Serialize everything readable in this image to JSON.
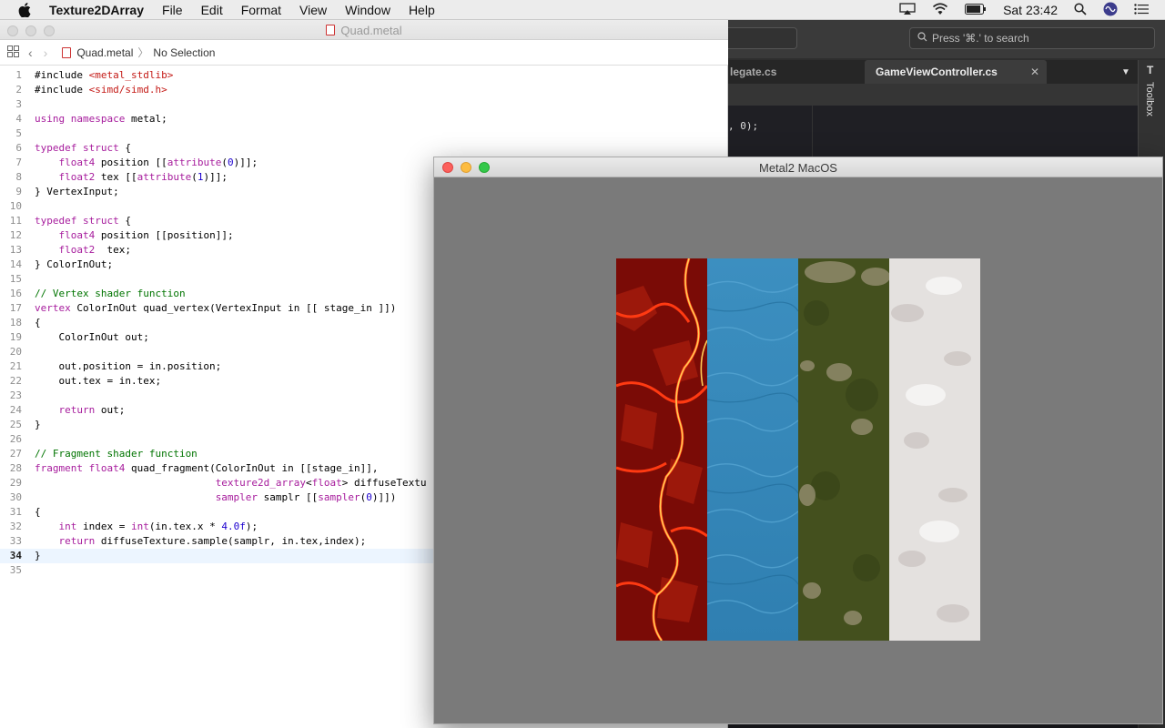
{
  "menubar": {
    "app_name": "Texture2DArray",
    "items": [
      "File",
      "Edit",
      "Format",
      "View",
      "Window",
      "Help"
    ],
    "clock": "Sat 23:42"
  },
  "editor": {
    "title": "Quad.metal",
    "breadcrumb_file": "Quad.metal",
    "breadcrumb_selection": "No Selection",
    "active_line": 34,
    "lines": [
      "#include <metal_stdlib>",
      "#include <simd/simd.h>",
      "",
      "using namespace metal;",
      "",
      "typedef struct {",
      "    float4 position [[attribute(0)]];",
      "    float2 tex [[attribute(1)]];",
      "} VertexInput;",
      "",
      "typedef struct {",
      "    float4 position [[position]];",
      "    float2  tex;",
      "} ColorInOut;",
      "",
      "// Vertex shader function",
      "vertex ColorInOut quad_vertex(VertexInput in [[ stage_in ]])",
      "{",
      "    ColorInOut out;",
      "",
      "    out.position = in.position;",
      "    out.tex = in.tex;",
      "",
      "    return out;",
      "}",
      "",
      "// Fragment shader function",
      "fragment float4 quad_fragment(ColorInOut in [[stage_in]],",
      "                              texture2d_array<float> diffuseTextu",
      "                              sampler samplr [[sampler(0)]])",
      "{",
      "    int index = int(in.tex.x * 4.0f);",
      "    return diffuseTexture.sample(samplr, in.tex,index);",
      "}",
      ""
    ]
  },
  "ide": {
    "search_placeholder": "Press '⌘.' to search",
    "tab_partial": "legate.cs",
    "tab_active": "GameViewController.cs",
    "code_snippet": ", 0);",
    "toolbox_label": "Toolbox"
  },
  "metal_window": {
    "title": "Metal2 MacOS",
    "textures": [
      "lava",
      "water",
      "grass",
      "snow"
    ]
  },
  "colors": {
    "keyword": "#a71d9d",
    "include": "#c41a16",
    "number": "#1c00cf",
    "comment": "#007400",
    "metal_bg": "#7a7a7a"
  }
}
